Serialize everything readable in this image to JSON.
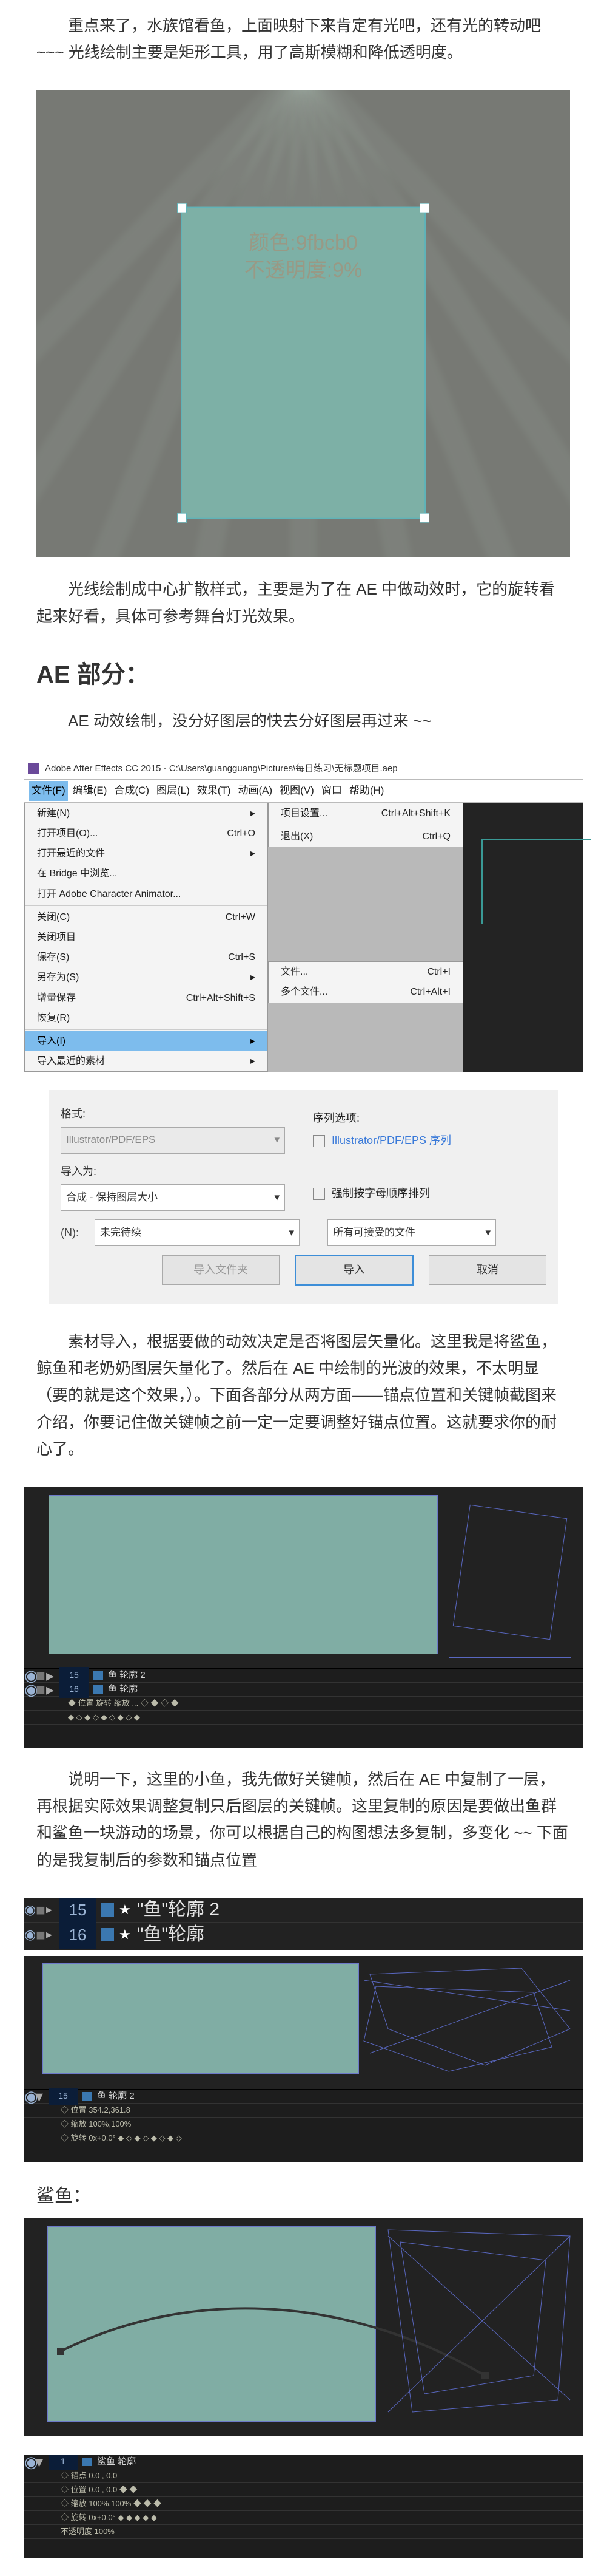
{
  "p1": "重点来了，水族馆看鱼，上面映射下来肯定有光吧，还有光的转动吧 ~~~ 光线绘制主要是矩形工具，用了高斯模糊和降低透明度。",
  "fig1_label_line1": "颜色:9fbcb0",
  "fig1_label_line2": "不透明度:9%",
  "p2": "光线绘制成中心扩散样式，主要是为了在 AE 中做动效时，它的旋转看起来好看，具体可参考舞台灯光效果。",
  "h_ae": "AE 部分：",
  "p3": "AE 动效绘制，没分好图层的快去分好图层再过来 ~~",
  "ae_title": "Adobe After Effects CC 2015 - C:\\Users\\guangguang\\Pictures\\每日练习\\无标题项目.aep",
  "menubar": [
    "文件(F)",
    "编辑(E)",
    "合成(C)",
    "图层(L)",
    "效果(T)",
    "动画(A)",
    "视图(V)",
    "窗口",
    "帮助(H)"
  ],
  "file_menu": [
    {
      "l": "新建(N)",
      "r": "",
      "arrow": true
    },
    {
      "l": "打开项目(O)...",
      "r": "Ctrl+O"
    },
    {
      "l": "打开最近的文件",
      "r": "",
      "arrow": true
    },
    {
      "l": "在 Bridge 中浏览...",
      "r": ""
    },
    {
      "l": "打开 Adobe Character Animator...",
      "r": ""
    },
    {
      "sep": true
    },
    {
      "l": "关闭(C)",
      "r": "Ctrl+W"
    },
    {
      "l": "关闭项目",
      "r": ""
    },
    {
      "l": "保存(S)",
      "r": "Ctrl+S"
    },
    {
      "l": "另存为(S)",
      "r": "",
      "arrow": true
    },
    {
      "l": "增量保存",
      "r": "Ctrl+Alt+Shift+S"
    },
    {
      "l": "恢复(R)",
      "r": ""
    },
    {
      "sep": true
    },
    {
      "l": "导入(I)",
      "r": "",
      "arrow": true,
      "hl": true
    },
    {
      "l": "导入最近的素材",
      "r": "",
      "arrow": true
    }
  ],
  "right_menu_top": [
    {
      "l": "项目设置...",
      "r": "Ctrl+Alt+Shift+K"
    },
    {
      "sep": true
    },
    {
      "l": "退出(X)",
      "r": "Ctrl+Q"
    }
  ],
  "sub_menu": [
    {
      "l": "文件...",
      "r": "Ctrl+I",
      "hl": true
    },
    {
      "l": "多个文件...",
      "r": "Ctrl+Alt+I"
    }
  ],
  "dlg": {
    "fmt_label": "格式:",
    "fmt_value": "Illustrator/PDF/EPS",
    "seq_opt_label": "序列选项:",
    "seq_chk": "Illustrator/PDF/EPS 序列",
    "import_as_label": "导入为:",
    "import_as_value": "合成 - 保持图层大小",
    "force_chk": "强制按字母顺序排列",
    "filename_label": "(N):",
    "filename_value": "未完待续",
    "filter_value": "所有可接受的文件",
    "btn_folder": "导入文件夹",
    "btn_import": "导入",
    "btn_cancel": "取消"
  },
  "p4": "素材导入，根据要做的动效决定是否将图层矢量化。这里我是将鲨鱼，鲸鱼和老奶奶图层矢量化了。然后在 AE 中绘制的光波的效果，不太明显（要的就是这个效果，）。下面各部分从两方面——锚点位置和关键帧截图来介绍，你要记住做关键帧之前一定一定要调整好锚点位置。这就要求你的耐心了。",
  "p5": "说明一下，这里的小鱼，我先做好关键帧，然后在 AE 中复制了一层，再根据实际效果调整复制只后图层的关键帧。这里复制的原因是要做出鱼群和鲨鱼一块游动的场景，你可以根据自己的构图想法多复制，多变化 ~~ 下面的是我复制后的参数和锚点位置",
  "layer_row1_num": "15",
  "layer_row1_txt": "\"鱼\"轮廓 2",
  "layer_row2_num": "16",
  "layer_row2_txt": "\"鱼\"轮廓",
  "h_shark": "鲨鱼："
}
